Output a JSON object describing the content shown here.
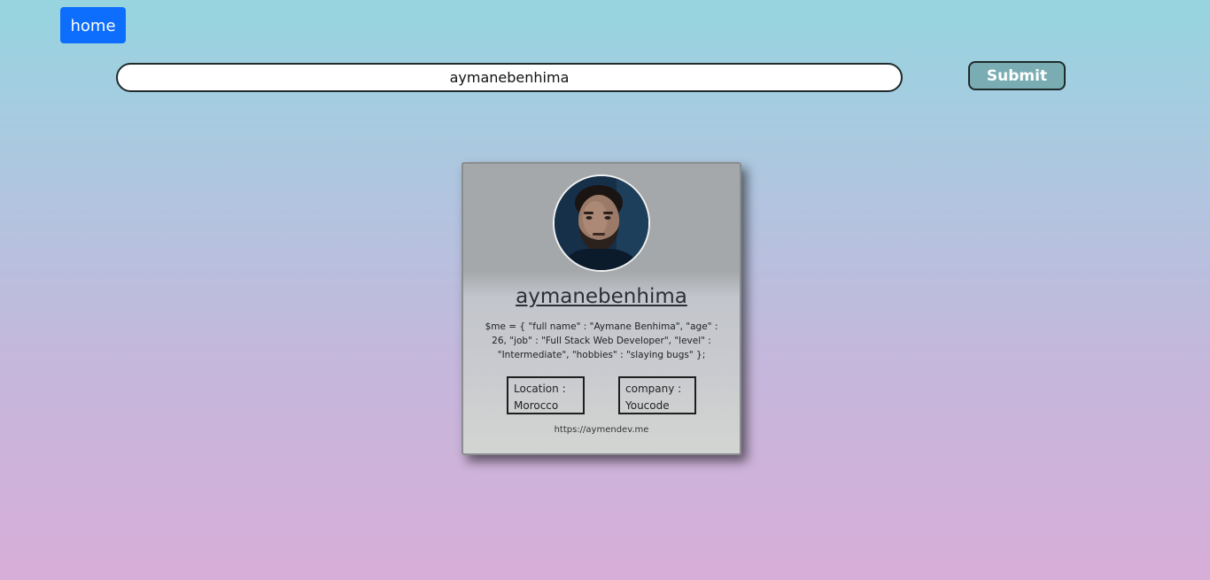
{
  "nav": {
    "home_label": "home"
  },
  "search": {
    "value": "aymanebenhima",
    "submit_label": "Submit"
  },
  "profile": {
    "avatar_icon": "user-avatar",
    "username": "aymanebenhima",
    "bio": "$me = { \"full name\" : \"Aymane Benhima\", \"age\" : 26, \"job\" : \"Full Stack Web Developer\", \"level\" : \"Intermediate\", \"hobbies\" : \"slaying bugs\" };",
    "location_label": "Location :",
    "location_value": "Morocco",
    "company_label": "company :",
    "company_value": "Youcode",
    "blog": "https://aymendev.me"
  },
  "colors": {
    "home_button": "#0d6efd",
    "submit_button": "#79adb3",
    "gradient_top": "#96d5e0",
    "gradient_bottom": "#d7aed8"
  }
}
